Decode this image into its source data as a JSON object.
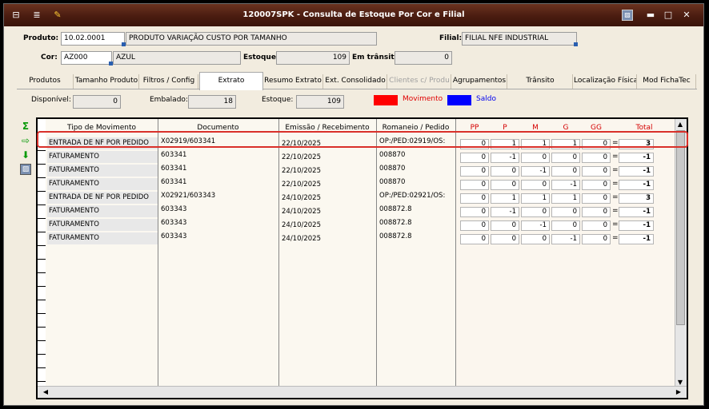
{
  "window": {
    "title": "120007SPK - Consulta de Estoque Por Cor e Filial",
    "buttons": {
      "minimize": "▬",
      "maximize": "□",
      "close": "✕"
    }
  },
  "header": {
    "produto_label": "Produto:",
    "produto_code": "10.02.0001",
    "produto_desc": "PRODUTO VARIAÇÃO CUSTO POR TAMANHO",
    "filial_label": "Filial:",
    "filial_value": "FILIAL NFE INDUSTRIAL",
    "cor_label": "Cor:",
    "cor_code": "AZ000",
    "cor_desc": "AZUL",
    "estoque_label": "Estoque:",
    "estoque_value": "109",
    "transito_label": "Em trânsito:",
    "transito_value": "0"
  },
  "tabs": [
    {
      "label": "Produtos",
      "state": "normal"
    },
    {
      "label": "Tamanho Produto",
      "state": "normal"
    },
    {
      "label": "Filtros / Config",
      "state": "normal"
    },
    {
      "label": "Extrato",
      "state": "active"
    },
    {
      "label": "Resumo Extrato",
      "state": "normal"
    },
    {
      "label": "Ext. Consolidado",
      "state": "normal"
    },
    {
      "label": "Clientes c/ Produ",
      "state": "disabled"
    },
    {
      "label": "Agrupamentos",
      "state": "normal"
    },
    {
      "label": "Trânsito",
      "state": "normal"
    },
    {
      "label": "Localização Física",
      "state": "normal"
    },
    {
      "label": "Mod FichaTec",
      "state": "normal"
    }
  ],
  "summary": {
    "disponivel_label": "Disponível:",
    "disponivel_value": "0",
    "embalado_label": "Embalado:",
    "embalado_value": "18",
    "estoque_label": "Estoque:",
    "estoque_value": "109",
    "legend_movimento": "Movimento",
    "legend_saldo": "Saldo",
    "colors": {
      "movimento": "#ff0000",
      "saldo": "#0000ff",
      "highlight": "#d9302a",
      "title_bar": "#5a2516"
    }
  },
  "tools": [
    "sigma-icon",
    "export-icon",
    "download-icon",
    "image-icon"
  ],
  "grid": {
    "columns": {
      "tipo": "Tipo de Movimento",
      "documento": "Documento",
      "emissao": "Emissão / Recebimento",
      "romaneio": "Romaneio / Pedido",
      "pp": "PP",
      "p": "P",
      "m": "M",
      "g": "G",
      "gg": "GG",
      "total": "Total"
    },
    "rows": [
      {
        "tipo": "ENTRADA DE NF POR PEDIDO",
        "documento": "X02919/603341",
        "emissao": "22/10/2025",
        "romaneio": "OP:/PED:02919/OS:",
        "pp": "0",
        "p": "1",
        "m": "1",
        "g": "1",
        "gg": "0",
        "eq": "=",
        "total": "3"
      },
      {
        "tipo": "FATURAMENTO",
        "documento": "603341",
        "emissao": "22/10/2025",
        "romaneio": "008870",
        "pp": "0",
        "p": "-1",
        "m": "0",
        "g": "0",
        "gg": "0",
        "eq": "=",
        "total": "-1"
      },
      {
        "tipo": "FATURAMENTO",
        "documento": "603341",
        "emissao": "22/10/2025",
        "romaneio": "008870",
        "pp": "0",
        "p": "0",
        "m": "-1",
        "g": "0",
        "gg": "0",
        "eq": "=",
        "total": "-1"
      },
      {
        "tipo": "FATURAMENTO",
        "documento": "603341",
        "emissao": "22/10/2025",
        "romaneio": "008870",
        "pp": "0",
        "p": "0",
        "m": "0",
        "g": "-1",
        "gg": "0",
        "eq": "=",
        "total": "-1"
      },
      {
        "tipo": "ENTRADA DE NF POR PEDIDO",
        "documento": "X02921/603343",
        "emissao": "24/10/2025",
        "romaneio": "OP:/PED:02921/OS:",
        "pp": "0",
        "p": "1",
        "m": "1",
        "g": "1",
        "gg": "0",
        "eq": "=",
        "total": "3"
      },
      {
        "tipo": "FATURAMENTO",
        "documento": "603343",
        "emissao": "24/10/2025",
        "romaneio": "008872.8",
        "pp": "0",
        "p": "-1",
        "m": "0",
        "g": "0",
        "gg": "0",
        "eq": "=",
        "total": "-1"
      },
      {
        "tipo": "FATURAMENTO",
        "documento": "603343",
        "emissao": "24/10/2025",
        "romaneio": "008872.8",
        "pp": "0",
        "p": "0",
        "m": "-1",
        "g": "0",
        "gg": "0",
        "eq": "=",
        "total": "-1"
      },
      {
        "tipo": "FATURAMENTO",
        "documento": "603343",
        "emissao": "24/10/2025",
        "romaneio": "008872.8",
        "pp": "0",
        "p": "0",
        "m": "0",
        "g": "-1",
        "gg": "0",
        "eq": "=",
        "total": "-1"
      }
    ]
  }
}
